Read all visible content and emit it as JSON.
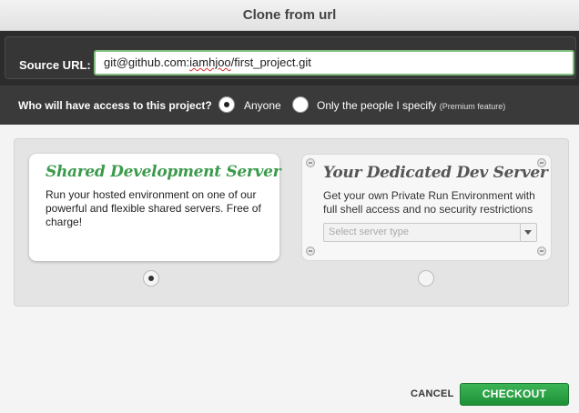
{
  "dialog": {
    "title": "Clone from url"
  },
  "source": {
    "label": "Source URL:",
    "value_prefix": "git@github.com:",
    "value_misspelled": "iamhjoo",
    "value_suffix": "/first_project.git"
  },
  "access": {
    "question": "Who will have access to this project?",
    "options": [
      {
        "label": "Anyone",
        "selected": true
      },
      {
        "label": "Only the people I specify",
        "note": "(Premium feature)",
        "selected": false
      }
    ]
  },
  "servers": {
    "shared": {
      "title": "Shared Development Server",
      "description": "Run your hosted environment on one of our powerful and flexible shared servers. Free of charge!",
      "selected": true,
      "title_color": "#3c9a4c"
    },
    "dedicated": {
      "title": "Your Dedicated Dev Server",
      "description": "Get your own Private Run Environment with full shell access and no security restrictions",
      "select_placeholder": "Select server type",
      "selected": false
    }
  },
  "footer": {
    "cancel_label": "CANCEL",
    "checkout_label": "CHECKOUT",
    "checkout_color": "#2aa446"
  }
}
